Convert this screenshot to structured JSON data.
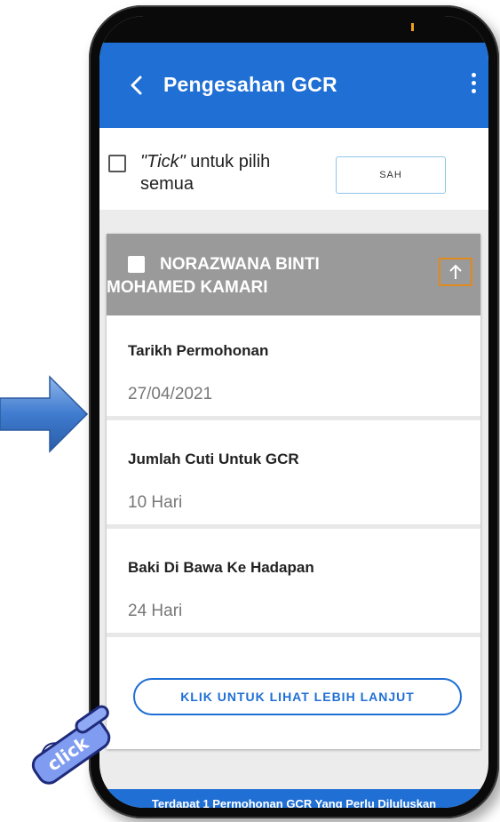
{
  "app_bar": {
    "title": "Pengesahan GCR"
  },
  "select_all": {
    "label_italic": "\"Tick\"",
    "label_rest": " untuk pilih semua",
    "sah_label": "SAH"
  },
  "application": {
    "name": "NORAZWANA BINTI MOHAMED KAMARI",
    "fields": [
      {
        "label": "Tarikh Permohonan",
        "value": "27/04/2021"
      },
      {
        "label": "Jumlah Cuti Untuk GCR",
        "value": "10 Hari"
      },
      {
        "label": "Baki Di Bawa Ke Hadapan",
        "value": "24 Hari"
      }
    ],
    "more_button": "KLIK UNTUK LIHAT LEBIH LANJUT"
  },
  "footer": {
    "text": "Terdapat 1 Permohonan GCR Yang Perlu Diluluskan"
  },
  "annotation": {
    "click_text": "click"
  },
  "colors": {
    "primary": "#1f6fd4",
    "header_gray": "#9a9a9a",
    "accent_orange": "#e08a1e"
  },
  "icons": {
    "back": "chevron-left-icon",
    "more": "more-vertical-icon",
    "collapse": "arrow-up-icon"
  }
}
